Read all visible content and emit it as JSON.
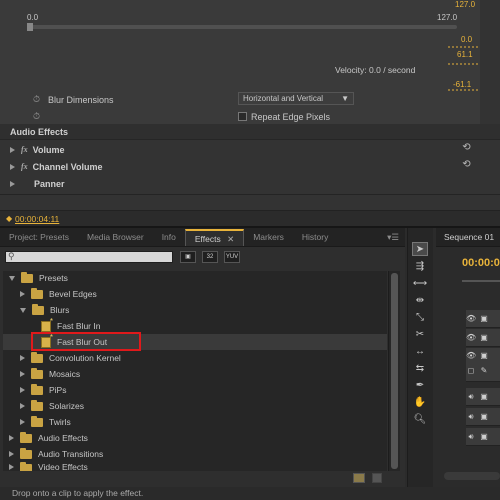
{
  "effect_controls": {
    "top_value": "127.0",
    "slider_min": "0.0",
    "slider_max": "127.0",
    "graph_values": [
      "0.0",
      "61.1",
      "-61.1"
    ],
    "velocity": "Velocity: 0.0 / second",
    "blur_dimensions_label": "Blur Dimensions",
    "blur_dimensions_value": "Horizontal and Vertical",
    "repeat_edge_label": "Repeat Edge Pixels",
    "audio_effects_label": "Audio Effects",
    "audio_effects": [
      {
        "label": "Volume",
        "fx": "fx"
      },
      {
        "label": "Channel Volume",
        "fx": "fx"
      },
      {
        "label": "Panner",
        "fx": ""
      }
    ],
    "timecode": "00:00:04:11"
  },
  "effects_panel": {
    "tabs": [
      "Project: Presets",
      "Media Browser",
      "Info",
      "Effects",
      "Markers",
      "History"
    ],
    "active_tab": "Effects",
    "buttons": [
      "32",
      "YUV"
    ],
    "tree": [
      {
        "label": "Presets",
        "level": 0,
        "type": "folder",
        "expanded": true
      },
      {
        "label": "Bevel Edges",
        "level": 1,
        "type": "folder",
        "expanded": false
      },
      {
        "label": "Blurs",
        "level": 1,
        "type": "folder",
        "expanded": true
      },
      {
        "label": "Fast Blur In",
        "level": 2,
        "type": "preset"
      },
      {
        "label": "Fast Blur Out",
        "level": 2,
        "type": "preset",
        "selected": true
      },
      {
        "label": "Convolution Kernel",
        "level": 1,
        "type": "folder",
        "expanded": false
      },
      {
        "label": "Mosaics",
        "level": 1,
        "type": "folder",
        "expanded": false
      },
      {
        "label": "PiPs",
        "level": 1,
        "type": "folder",
        "expanded": false
      },
      {
        "label": "Solarizes",
        "level": 1,
        "type": "folder",
        "expanded": false
      },
      {
        "label": "Twirls",
        "level": 1,
        "type": "folder",
        "expanded": false
      },
      {
        "label": "Audio Effects",
        "level": 0,
        "type": "folder",
        "expanded": false
      },
      {
        "label": "Audio Transitions",
        "level": 0,
        "type": "folder",
        "expanded": false
      },
      {
        "label": "Video Effects",
        "level": 0,
        "type": "folder",
        "expanded": false
      }
    ],
    "status": "Drop onto a clip to apply the effect."
  },
  "sequence": {
    "tab_label": "Sequence 01",
    "timecode": "00:00:0"
  },
  "colors": {
    "accent": "#e8b33a",
    "highlight_box": "#e0191b",
    "folder": "#c9a343"
  }
}
